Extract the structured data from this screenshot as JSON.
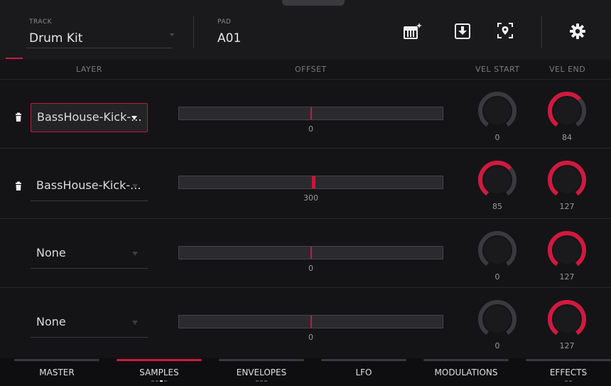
{
  "header": {
    "track_label": "TRACK",
    "track_value": "Drum Kit",
    "pad_label": "PAD",
    "pad_value": "A01",
    "icons": [
      "keyboard-sparkle-icon",
      "download-icon",
      "locate-icon",
      "gear-icon"
    ]
  },
  "columns": {
    "layer": "LAYER",
    "offset": "OFFSET",
    "vel_start": "VEL START",
    "vel_end": "VEL END"
  },
  "layers": [
    {
      "sample": "BassHouse-Kick-...",
      "offset": "0",
      "offset_fraction": 0.5,
      "vel_start": "0",
      "vel_end": "84",
      "has_trash": true,
      "active": true
    },
    {
      "sample": "BassHouse-Kick-...",
      "offset": "300",
      "offset_fraction": 0.51,
      "vel_start": "85",
      "vel_end": "127",
      "has_trash": true,
      "active": false
    },
    {
      "sample": "None",
      "offset": "0",
      "offset_fraction": 0.5,
      "vel_start": "0",
      "vel_end": "127",
      "has_trash": false,
      "active": false
    },
    {
      "sample": "None",
      "offset": "0",
      "offset_fraction": 0.5,
      "vel_start": "0",
      "vel_end": "127",
      "has_trash": false,
      "active": false
    }
  ],
  "tabs": [
    {
      "label": "MASTER",
      "active": false
    },
    {
      "label": "SAMPLES",
      "active": true
    },
    {
      "label": "ENVELOPES",
      "active": false
    },
    {
      "label": "LFO",
      "active": false
    },
    {
      "label": "MODULATIONS",
      "active": false
    },
    {
      "label": "EFFECTS",
      "active": false
    }
  ],
  "colors": {
    "accent": "#d0193f",
    "background": "#141416",
    "knob_body": "#1a1a1c"
  }
}
